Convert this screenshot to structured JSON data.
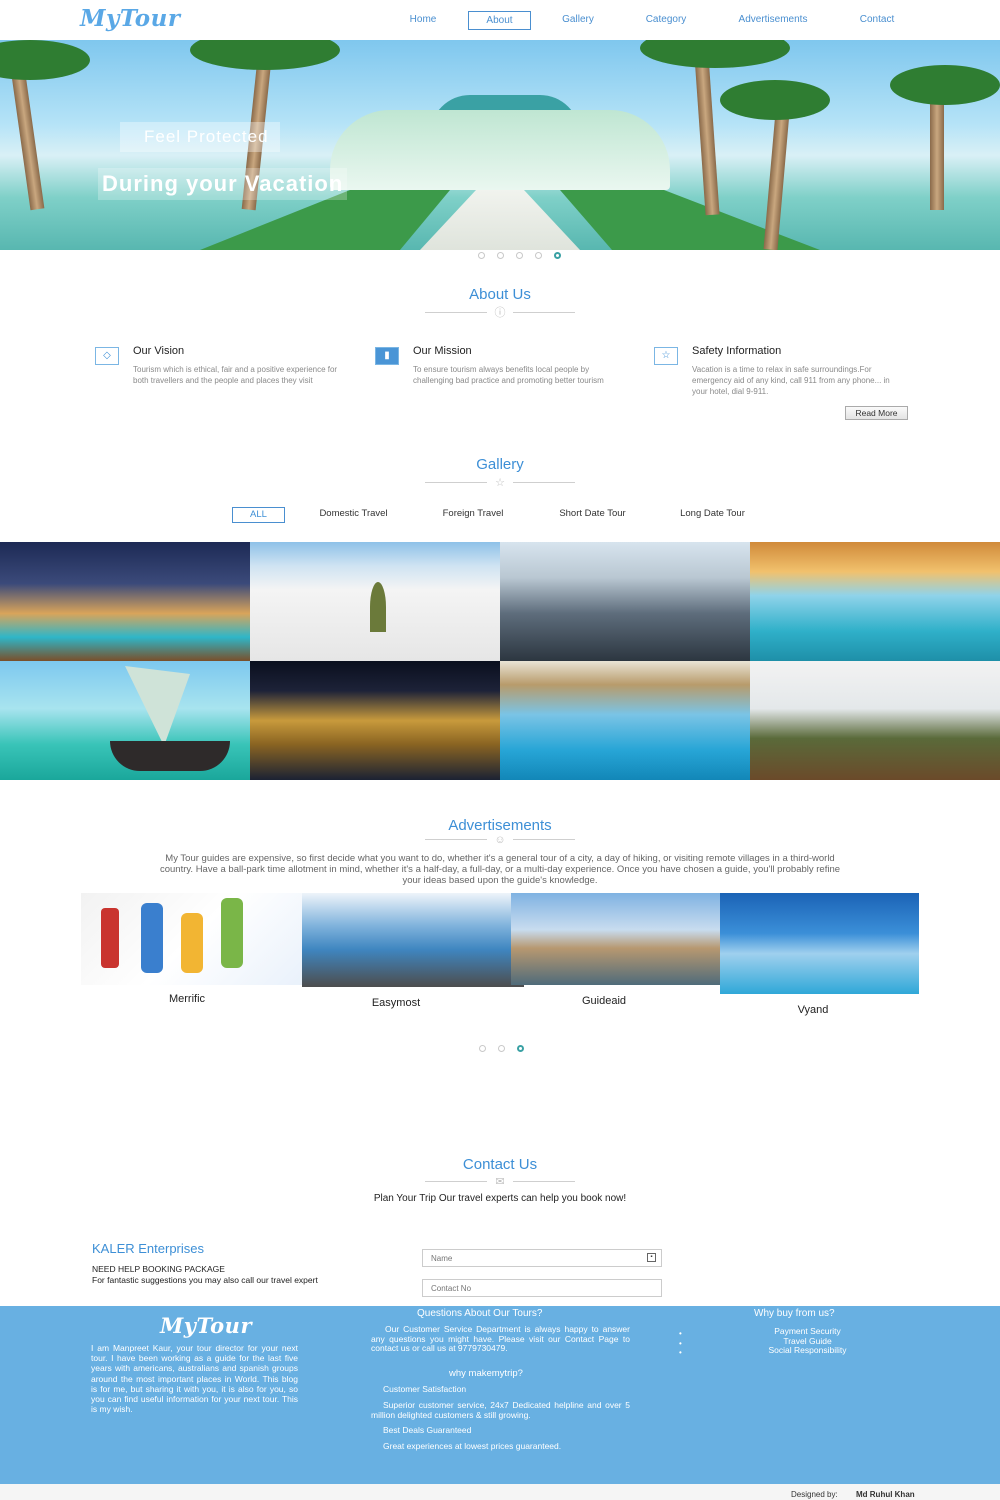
{
  "brand": "MyTour",
  "nav": {
    "items": [
      "Home",
      "About",
      "Gallery",
      "Category",
      "Advertisements",
      "Contact"
    ],
    "active": "About"
  },
  "hero": {
    "caption_line1": "Feel Protected",
    "caption_line2": "During your Vacation",
    "slides": 5,
    "active_slide": 5
  },
  "about": {
    "title": "About Us",
    "columns": [
      {
        "icon": "diamond-icon",
        "heading": "Our Vision",
        "text": "Tourism which is ethical, fair and a positive experience for both travellers and the people and places they visit"
      },
      {
        "icon": "book-icon",
        "heading": "Our Mission",
        "text": "To ensure tourism always benefits local people by challenging bad practice and promoting better tourism"
      },
      {
        "icon": "star-icon",
        "heading": "Safety Information",
        "text": "Vacation is a time to relax in safe surroundings.For emergency aid of any kind, call 911 from any phone... in your hotel, dial 9-911."
      }
    ],
    "read_more": "Read More"
  },
  "gallery": {
    "title": "Gallery",
    "filters": [
      "ALL",
      "Domestic Travel",
      "Foreign Travel",
      "Short Date Tour",
      "Long Date Tour"
    ],
    "active_filter": "ALL"
  },
  "ads": {
    "title": "Advertisements",
    "text": "My Tour guides are expensive, so first decide what you want to do, whether it's a general tour of a city, a day of hiking, or visiting remote villages in a third-world country. Have a ball-park time allotment in mind, whether it's a half-day, a full-day, or a multi-day experience. Once you have chosen a guide, you'll probably refine your ideas based upon the guide's knowledge.",
    "items": [
      "Merrific",
      "Easymost",
      "Guideaid",
      "Vyand"
    ],
    "slides": 3,
    "active_slide": 3
  },
  "contact": {
    "title": "Contact Us",
    "subtitle": "Plan Your Trip Our travel experts can help you book now!",
    "company": "KALER Enterprises",
    "help_line1": "NEED HELP BOOKING PACKAGE",
    "help_line2": "For fantastic suggestions you may also call our travel expert",
    "name_placeholder": "Name",
    "contact_placeholder": "Contact No"
  },
  "footer": {
    "about": "I am Manpreet Kaur, your tour director for your next tour. I have been working as a guide for the last five years with americans, australians and spanish groups around the most important places in World. This blog is for me, but sharing it with you, it is also for you, so you can find useful information for your next tour. This is my wish.",
    "questions_title": "Questions About Our Tours?",
    "questions_text": "Our Customer Service Department is always happy to answer any questions you might have. Please visit our Contact Page to contact us or call us at 9779730479.",
    "why_make_title": "why makemytrip?",
    "why_make_items": [
      "Customer Satisfaction",
      "Superior customer service, 24x7 Dedicated helpline and over 5 million delighted customers & still growing.",
      "Best Deals Guaranteed",
      "Great experiences at lowest prices guaranteed."
    ],
    "why_buy_title": "Why buy from us?",
    "why_buy_items": [
      "Payment Security",
      "Travel Guide",
      "Social Responsibility"
    ]
  },
  "credit": {
    "label": "Designed by:",
    "name": "Md Ruhul Khan"
  },
  "colors": {
    "accent": "#3d8fd6",
    "footer": "#68b0e2"
  }
}
